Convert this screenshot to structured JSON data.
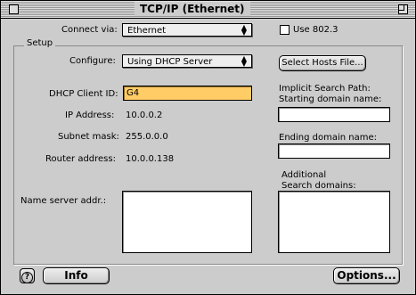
{
  "window": {
    "title": "TCP/IP (Ethernet)"
  },
  "connect": {
    "label": "Connect via:",
    "value": "Ethernet"
  },
  "use8023": {
    "label": "Use 802.3",
    "checked": false
  },
  "setup": {
    "label": "Setup",
    "configure_label": "Configure:",
    "configure_value": "Using DHCP Server",
    "select_hosts_button": "Select Hosts File...",
    "dhcp_client_label": "DHCP Client ID:",
    "dhcp_client_value": "G4",
    "ip_label": "IP Address:",
    "ip_value": "10.0.0.2",
    "subnet_label": "Subnet mask:",
    "subnet_value": "255.0.0.0",
    "router_label": "Router address:",
    "router_value": "10.0.0.138",
    "name_server_label": "Name server addr.:",
    "implicit_label_1": "Implicit Search Path:",
    "implicit_label_2": "Starting domain name:",
    "ending_label": "Ending domain name:",
    "additional_label_1": "Additional",
    "additional_label_2": "Search domains:"
  },
  "buttons": {
    "help": "?",
    "info": "Info",
    "options": "Options..."
  },
  "colors": {
    "field_highlight": "#ffcc66",
    "window_bg": "#cccccc"
  }
}
